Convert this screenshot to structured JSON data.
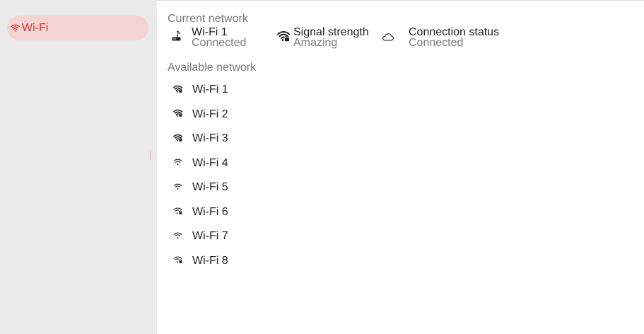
{
  "sidebar": {
    "items": [
      {
        "label": "Wi-Fi",
        "icon": "wifi-icon",
        "active": true
      }
    ]
  },
  "current": {
    "section_label": "Current network",
    "network": {
      "name": "Wi-Fi 1",
      "status": "Connected",
      "icon": "router-icon"
    },
    "signal": {
      "label": "Signal strength",
      "value": "Amazing",
      "icon": "wifi-signal-icon"
    },
    "connection": {
      "label": "Connection status",
      "value": "Connected",
      "icon": "cloud-icon"
    }
  },
  "available": {
    "section_label": "Available network",
    "networks": [
      {
        "name": "Wi-Fi 1",
        "icon": "wifi-locked-strong-icon"
      },
      {
        "name": "Wi-Fi 2",
        "icon": "wifi-locked-strong-icon"
      },
      {
        "name": "Wi-Fi 3",
        "icon": "wifi-locked-strong-icon"
      },
      {
        "name": "Wi-Fi 4",
        "icon": "wifi-weak-icon"
      },
      {
        "name": "Wi-Fi 5",
        "icon": "wifi-weak-icon"
      },
      {
        "name": "Wi-Fi 6",
        "icon": "wifi-locked-medium-icon"
      },
      {
        "name": "Wi-Fi 7",
        "icon": "wifi-weak-icon"
      },
      {
        "name": "Wi-Fi 8",
        "icon": "wifi-locked-medium-icon"
      }
    ]
  },
  "colors": {
    "accent": "#e0312f",
    "accent_bg": "#f4d3d3",
    "sidebar_bg": "#eaeaea",
    "muted_text": "#777777"
  }
}
